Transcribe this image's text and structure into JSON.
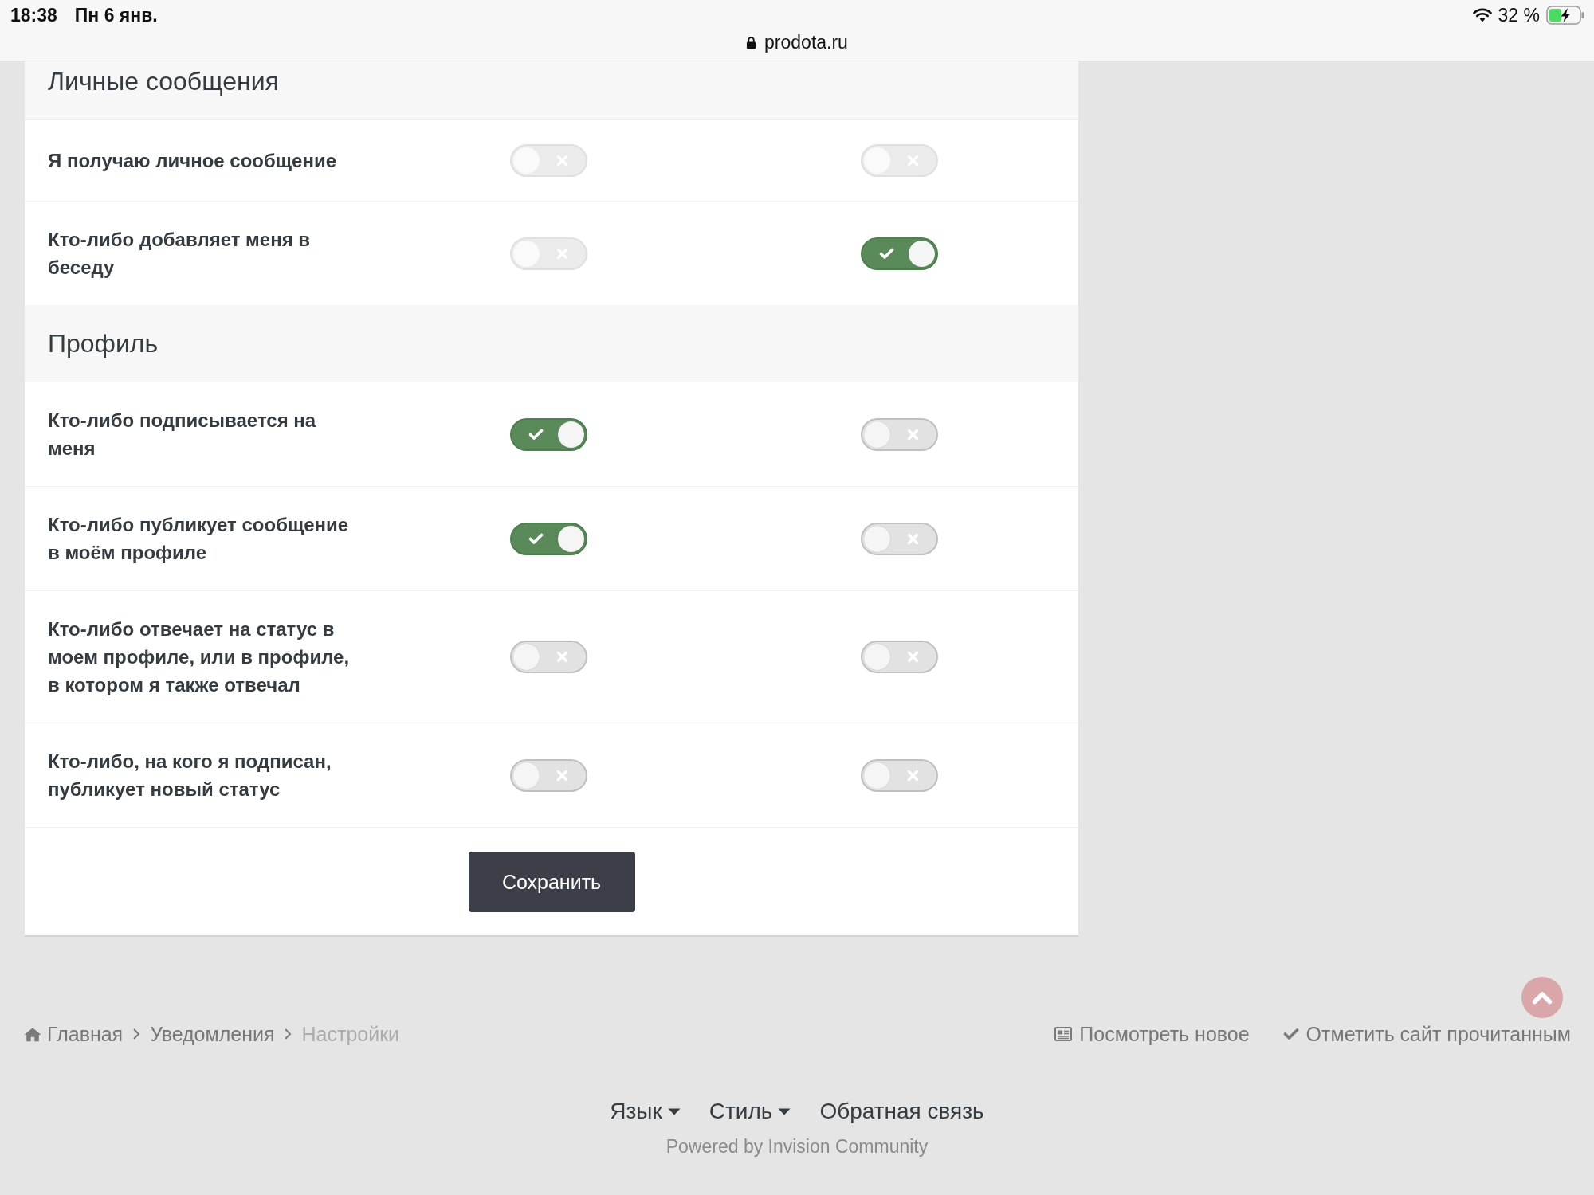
{
  "status_bar": {
    "time": "18:38",
    "date": "Пн 6 янв.",
    "url": "prodota.ru",
    "battery": "32 %"
  },
  "sections": [
    {
      "title": "Личные сообщения",
      "rows": [
        {
          "label": "Я получаю личное сообщение",
          "toggles": [
            {
              "on": false,
              "disabled": true
            },
            {
              "on": false,
              "disabled": true
            }
          ]
        },
        {
          "label": "Кто-либо добавляет меня в беседу",
          "toggles": [
            {
              "on": false,
              "disabled": true
            },
            {
              "on": true,
              "disabled": false
            }
          ]
        }
      ]
    },
    {
      "title": "Профиль",
      "rows": [
        {
          "label": "Кто-либо подписывается на меня",
          "toggles": [
            {
              "on": true,
              "disabled": false
            },
            {
              "on": false,
              "disabled": false
            }
          ]
        },
        {
          "label": "Кто-либо публикует сообщение в моём профиле",
          "toggles": [
            {
              "on": true,
              "disabled": false
            },
            {
              "on": false,
              "disabled": false
            }
          ]
        },
        {
          "label": "Кто-либо отвечает на статус в моем профиле, или в профиле, в котором я также отвечал",
          "toggles": [
            {
              "on": false,
              "disabled": false
            },
            {
              "on": false,
              "disabled": false
            }
          ]
        },
        {
          "label": "Кто-либо, на кого я подписан, публикует новый статус",
          "toggles": [
            {
              "on": false,
              "disabled": false
            },
            {
              "on": false,
              "disabled": false
            }
          ]
        }
      ]
    }
  ],
  "save_button": "Сохранить",
  "breadcrumb": [
    {
      "label": "Главная",
      "kind": "home",
      "current": false
    },
    {
      "label": "Уведомления",
      "kind": "page",
      "current": false
    },
    {
      "label": "Настройки",
      "kind": "page",
      "current": true
    }
  ],
  "activity_links": [
    {
      "kind": "new_content",
      "label": "Посмотреть новое"
    },
    {
      "kind": "mark_read",
      "label": "Отметить сайт прочитанным"
    }
  ],
  "footer_menu": [
    {
      "label": "Язык",
      "dropdown": true
    },
    {
      "label": "Стиль",
      "dropdown": true
    },
    {
      "label": "Обратная связь",
      "dropdown": false
    }
  ],
  "powered_by": "Powered by Invision Community"
}
